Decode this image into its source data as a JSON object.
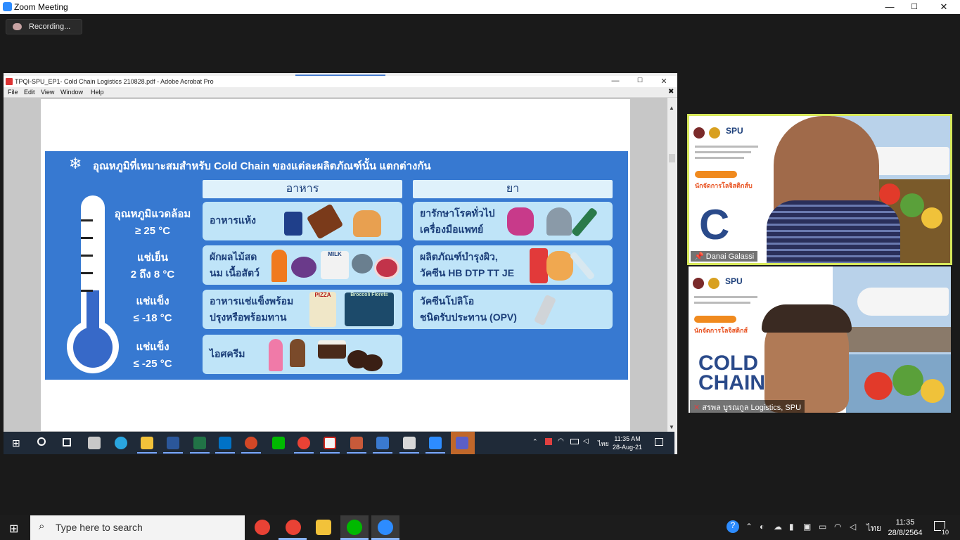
{
  "zoom": {
    "title": "Zoom Meeting",
    "recording_label": "Recording...",
    "minimize": "—",
    "maximize": "☐",
    "close": "✕"
  },
  "acrobat": {
    "title": "TPQI-SPU_EP1- Cold Chain Logistics 210828.pdf - Adobe Acrobat Pro",
    "menu": [
      "File",
      "Edit",
      "View",
      "Window",
      "Help"
    ],
    "close_doc": "✖"
  },
  "slide": {
    "title": "อุณหภูมิที่เหมาะสมสำหรับ Cold Chain ของแต่ละผลิตภัณฑ์นั้น แตกต่างกัน",
    "col_food": "อาหาร",
    "col_medicine": "ยา",
    "rows": [
      {
        "label1": "อุณหภูมิแวดล้อม",
        "label2": "≥ 25 °C",
        "food1": "อาหารแห้ง",
        "food2": "",
        "med1": "ยารักษาโรคทั่วไป",
        "med2": "เครื่องมือแพทย์"
      },
      {
        "label1": "แช่เย็น",
        "label2": "2 ถึง 8 °C",
        "food1": "ผักผลไม้สด",
        "food2": "นม เนื้อสัตว์",
        "med1": "ผลิตภัณฑ์บำรุงผิว,",
        "med2": "วัคซีน HB DTP TT JE"
      },
      {
        "label1": "แช่แข็ง",
        "label2": "≤ -18 °C",
        "food1": "อาหารแช่แข็งพร้อม",
        "food2": "ปรุงหรือพร้อมทาน",
        "med1": "วัคซีนโปลิโอ",
        "med2": "ชนิดรับประทาน (OPV)"
      },
      {
        "label1": "แช่แข็ง",
        "label2": "≤ -25 °C",
        "food1": "ไอศครีม",
        "food2": ""
      }
    ],
    "icon_labels": {
      "milk": "MILK",
      "pizza": "PIZZA",
      "broccoli": "Broccoli Florets"
    }
  },
  "inner_taskbar": {
    "time": "11:35 AM",
    "date": "28-Aug-21",
    "lang": "ไทย"
  },
  "participants": [
    {
      "name": "Danai Galassi",
      "poster_brand": "SPU",
      "poster_text": "นักจัดการโลจิสติกส์บ",
      "poster_word": "C"
    },
    {
      "name": "สรพล บูรณกูล Logistics, SPU",
      "poster_brand": "SPU",
      "poster_text": "นักจัดการโลจิสติกส์",
      "poster_word": "COLD CHAIN"
    }
  ],
  "os": {
    "search_placeholder": "Type here to search",
    "time": "11:35",
    "date": "28/8/2564",
    "lang": "ไทย",
    "notif_count": "10"
  },
  "colors": {
    "slide_bg": "#3779d1",
    "cell_bg": "#bfe4f8",
    "header_bg": "#dff1fb",
    "active_speaker": "#d7e85a"
  }
}
